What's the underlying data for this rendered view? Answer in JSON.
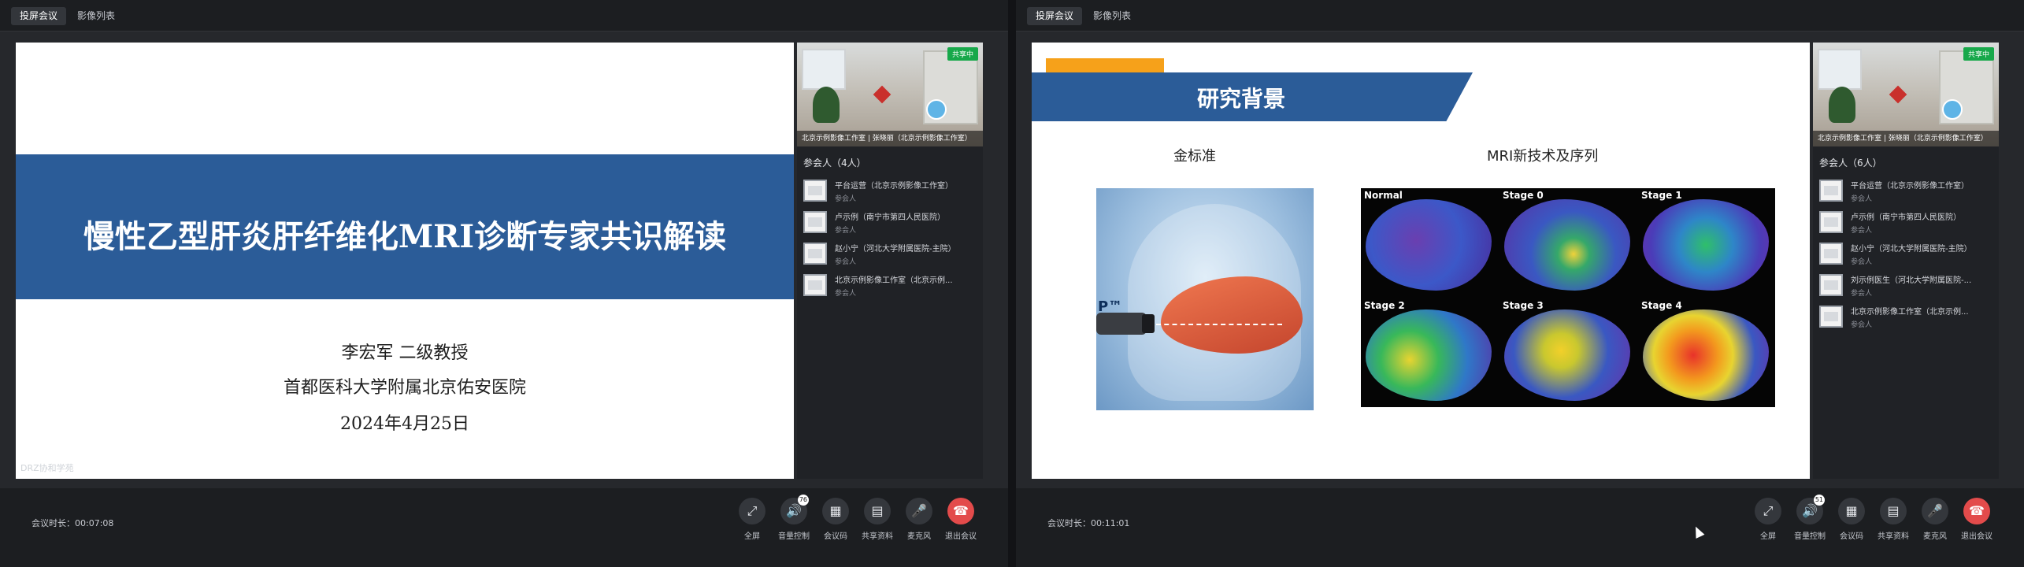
{
  "tabs": [
    "投屏会议",
    "影像列表"
  ],
  "panels": [
    {
      "duration": "会议时长：00:07:08",
      "slide": {
        "title": "慢性乙型肝炎肝纤维化MRI诊断专家共识解读",
        "author": "李宏军 二级教授",
        "affiliation": "首都医科大学附属北京佑安医院",
        "date": "2024年4月25日",
        "watermark": "DRZ协和学苑"
      },
      "video": {
        "badge": "共享中",
        "caption": "北京示例影像工作室 | 张晓丽（北京示例影像工作室）"
      },
      "participants_title": "参会人（4人）",
      "participants": [
        {
          "name": "平台运营（北京示例影像工作室）",
          "role": "参会人"
        },
        {
          "name": "卢示例（南宁市第四人民医院）",
          "role": "参会人"
        },
        {
          "name": "赵小宁（河北大学附属医院-主院）",
          "role": "参会人"
        },
        {
          "name": "北京示例影像工作室（北京示例...",
          "role": "参会人"
        }
      ],
      "controls": [
        {
          "icon": "fullscreen-icon",
          "glyph": "⤢",
          "label": "全屏"
        },
        {
          "icon": "speaker-icon",
          "glyph": "🔊",
          "label": "音量控制",
          "badge": "76"
        },
        {
          "icon": "qrcode-icon",
          "glyph": "▦",
          "label": "会议码"
        },
        {
          "icon": "document-icon",
          "glyph": "▤",
          "label": "共享资料"
        },
        {
          "icon": "microphone-icon",
          "glyph": "🎤",
          "label": "麦克风"
        },
        {
          "icon": "hangup-icon",
          "glyph": "☎",
          "label": "退出会议"
        }
      ]
    },
    {
      "duration": "会议时长：00:11:01",
      "slide": {
        "heading": "研究背景",
        "gold_label": "金标准",
        "mri_label": "MRI新技术及序列",
        "stages": [
          "Normal",
          "Stage 0",
          "Stage 1",
          "Stage 2",
          "Stage 3",
          "Stage 4"
        ],
        "illustration_text": "P™"
      },
      "video": {
        "badge": "共享中",
        "caption": "北京示例影像工作室 | 张晓丽（北京示例影像工作室）"
      },
      "participants_title": "参会人（6人）",
      "participants": [
        {
          "name": "平台运营（北京示例影像工作室）",
          "role": "参会人"
        },
        {
          "name": "卢示例（南宁市第四人民医院）",
          "role": "参会人"
        },
        {
          "name": "赵小宁（河北大学附属医院-主院）",
          "role": "参会人"
        },
        {
          "name": "刘示例医生（河北大学附属医院-...",
          "role": "参会人"
        },
        {
          "name": "北京示例影像工作室（北京示例...",
          "role": "参会人"
        }
      ],
      "controls": [
        {
          "icon": "fullscreen-icon",
          "glyph": "⤢",
          "label": "全屏"
        },
        {
          "icon": "speaker-icon",
          "glyph": "🔊",
          "label": "音量控制",
          "badge": "51"
        },
        {
          "icon": "qrcode-icon",
          "glyph": "▦",
          "label": "会议码"
        },
        {
          "icon": "document-icon",
          "glyph": "▤",
          "label": "共享资料"
        },
        {
          "icon": "microphone-icon",
          "glyph": "🎤",
          "label": "麦克风"
        },
        {
          "icon": "hangup-icon",
          "glyph": "☎",
          "label": "退出会议"
        }
      ]
    }
  ],
  "colors": {
    "slide_band": "#2b5c98",
    "accent_orange": "#f6a11a",
    "share_badge": "#17a84a",
    "hangup": "#e34b4b"
  }
}
